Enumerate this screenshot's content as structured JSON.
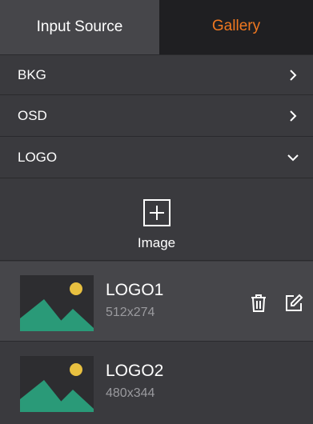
{
  "tabs": {
    "input_source": "Input Source",
    "gallery": "Gallery"
  },
  "menu": [
    {
      "label": "BKG",
      "icon": "chevron-right-icon"
    },
    {
      "label": "OSD",
      "icon": "chevron-right-icon"
    },
    {
      "label": "LOGO",
      "icon": "chevron-down-icon"
    }
  ],
  "add": {
    "label": "Image",
    "icon": "plus-box-icon"
  },
  "logos": [
    {
      "name": "LOGO1",
      "size": "512x274"
    },
    {
      "name": "LOGO2",
      "size": "480x344"
    }
  ],
  "colors": {
    "accent": "#f07820",
    "panel": "#3a3a3e",
    "selected": "#46464a",
    "thumb_mountain": "#2a9a78",
    "thumb_sun": "#e8c040"
  }
}
